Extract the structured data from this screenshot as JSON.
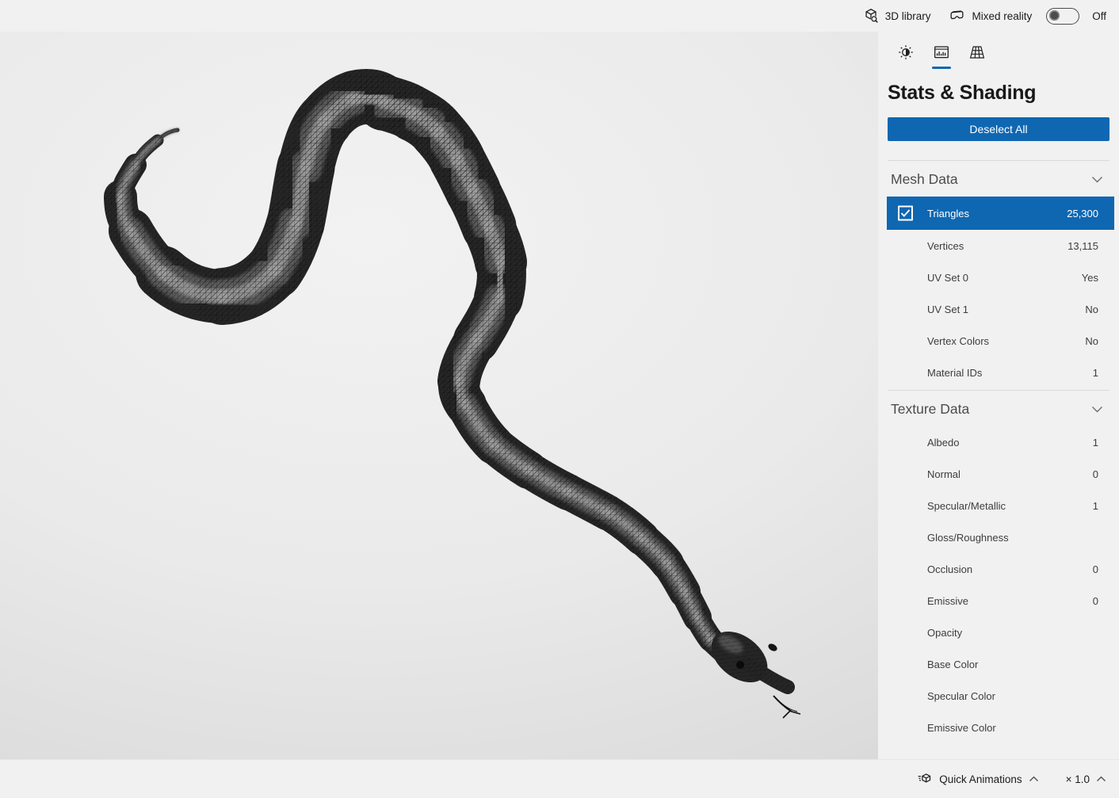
{
  "top_bar": {
    "library_label": "3D library",
    "mixed_reality_label": "Mixed reality",
    "toggle_state": "Off"
  },
  "viewport": {
    "model_description": "Wireframe 3D snake model"
  },
  "panel": {
    "title": "Stats & Shading",
    "deselect_button_label": "Deselect All",
    "tabs": [
      {
        "icon": "sun-icon",
        "active": false
      },
      {
        "icon": "stats-chart-icon",
        "active": true
      },
      {
        "icon": "grid-table-icon",
        "active": false
      }
    ],
    "mesh_section": {
      "header": "Mesh Data",
      "rows": [
        {
          "label": "Triangles",
          "value": "25,300",
          "selected": true
        },
        {
          "label": "Vertices",
          "value": "13,115",
          "selected": false
        },
        {
          "label": "UV Set 0",
          "value": "Yes",
          "selected": false
        },
        {
          "label": "UV Set 1",
          "value": "No",
          "selected": false
        },
        {
          "label": "Vertex Colors",
          "value": "No",
          "selected": false
        },
        {
          "label": "Material IDs",
          "value": "1",
          "selected": false
        }
      ]
    },
    "texture_section": {
      "header": "Texture Data",
      "rows": [
        {
          "label": "Albedo",
          "value": "1",
          "selected": false
        },
        {
          "label": "Normal",
          "value": "0",
          "selected": false
        },
        {
          "label": "Specular/Metallic",
          "value": "1",
          "selected": false
        },
        {
          "label": "Gloss/Roughness",
          "value": "",
          "selected": false
        },
        {
          "label": "Occlusion",
          "value": "0",
          "selected": false
        },
        {
          "label": "Emissive",
          "value": "0",
          "selected": false
        },
        {
          "label": "Opacity",
          "value": "",
          "selected": false
        },
        {
          "label": "Base Color",
          "value": "",
          "selected": false
        },
        {
          "label": "Specular Color",
          "value": "",
          "selected": false
        },
        {
          "label": "Emissive Color",
          "value": "",
          "selected": false
        }
      ]
    }
  },
  "bottom_bar": {
    "quick_animations_label": "Quick Animations",
    "playback_speed_label": "× 1.0"
  },
  "colors": {
    "accent_blue": "#0f67b2",
    "selected_row_blue": "#0f67b2",
    "panel_bg": "#f1f1f1"
  }
}
